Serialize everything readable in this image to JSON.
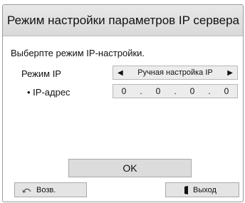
{
  "dialog": {
    "title": "Режим настройки параметров IP сервера",
    "instruction": "Выберпте режим IP-настройки."
  },
  "ip_mode": {
    "label": "Режим IP",
    "value": "Ручная настройка IP",
    "prev_icon": "arrow-left-icon",
    "next_icon": "arrow-right-icon"
  },
  "ip_address": {
    "label": "• IP-адрес",
    "octets": [
      "0",
      "0",
      "0",
      "0"
    ],
    "separator": "."
  },
  "buttons": {
    "ok": "OK",
    "back": "Возв.",
    "back_icon": "return-arrow-icon",
    "exit": "Выход",
    "exit_icon": "exit-door-icon"
  }
}
